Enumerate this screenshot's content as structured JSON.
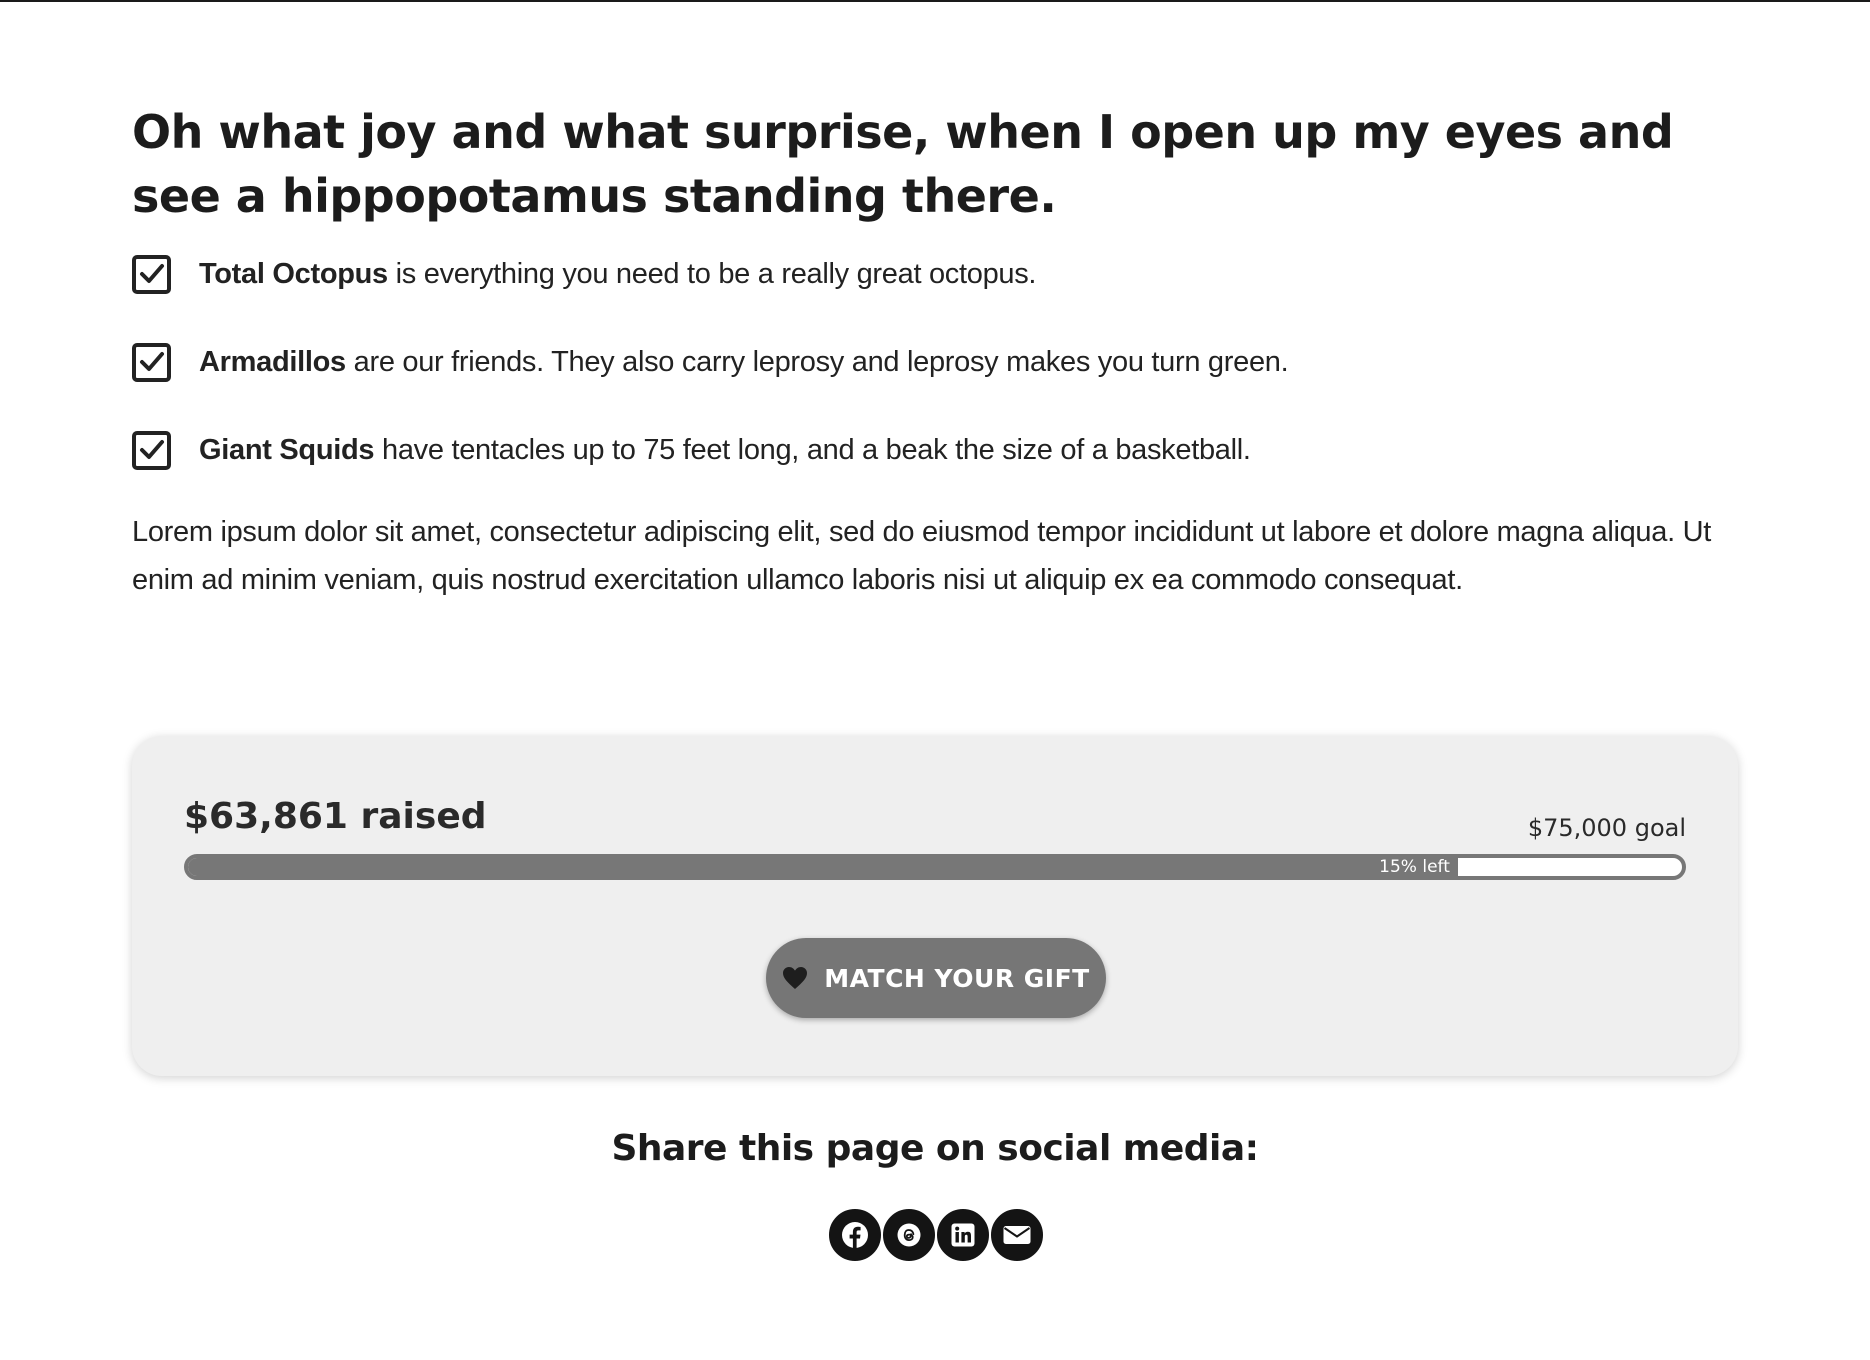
{
  "headline": "Oh what joy and what surprise, when I open up my eyes and see a hippopotamus standing there.",
  "features": [
    {
      "bold": "Total Octopus",
      "text": " is everything you need to be a really great octopus."
    },
    {
      "bold": "Armadillos",
      "text": " are our friends. They also carry leprosy and leprosy makes you turn green."
    },
    {
      "bold": "Giant Squids",
      "text": " have tentacles up to 75 feet long, and a beak the size of a basketball."
    }
  ],
  "body_text": "Lorem ipsum dolor sit amet, consectetur adipiscing elit, sed do eiusmod tempor incididunt ut labore et dolore magna aliqua. Ut enim ad minim veniam, quis nostrud exercitation ullamco laboris nisi ut aliquip ex ea commodo consequat.",
  "fundraiser": {
    "raised_label": "$63,861 raised",
    "goal_label": "$75,000 goal",
    "remaining_label": "15% left",
    "progress_percent": 85,
    "button_label": "MATCH YOUR GIFT",
    "button_icon": "heart-icon"
  },
  "share": {
    "heading": "Share this page on social media:",
    "icons": [
      "facebook-icon",
      "threads-icon",
      "linkedin-icon",
      "email-icon"
    ]
  },
  "colors": {
    "progress": "#777777",
    "card_background": "#efefef",
    "button": "#767676",
    "social": "#141414"
  }
}
